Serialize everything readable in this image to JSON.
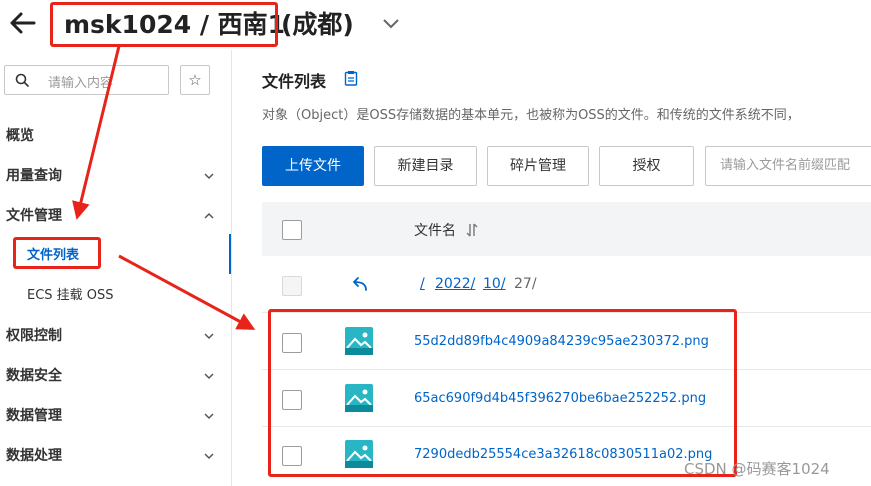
{
  "header": {
    "bucket_name": "msk1024 / 西南1",
    "region_suffix": "(成都)"
  },
  "sidebar": {
    "search_placeholder": "请输入内容",
    "items": [
      {
        "label": "概览"
      },
      {
        "label": "用量查询"
      },
      {
        "label": "文件管理"
      },
      {
        "label": "文件列表"
      },
      {
        "label": "ECS 挂载 OSS"
      },
      {
        "label": "权限控制"
      },
      {
        "label": "数据安全"
      },
      {
        "label": "数据管理"
      },
      {
        "label": "数据处理"
      }
    ]
  },
  "main": {
    "title": "文件列表",
    "description": "对象（Object）是OSS存储数据的基本单元，也被称为OSS的文件。和传统的文件系统不同，",
    "buttons": {
      "upload": "上传文件",
      "new_dir": "新建目录",
      "fragments": "碎片管理",
      "authorize": "授权"
    },
    "file_search_placeholder": "请输入文件名前缀匹配",
    "table": {
      "col_filename": "文件名",
      "breadcrumb": [
        "/",
        "2022/",
        "10/",
        "27/"
      ],
      "files": [
        "55d2dd89fb4c4909a84239c95ae230372.png",
        "65ac690f9d4b45f396270be6bae252252.png",
        "7290dedb25554ce3a32618c0830511a02.png"
      ]
    }
  },
  "watermark": "CSDN @码赛客1024",
  "colors": {
    "primary": "#0064c8",
    "annotation": "#e8231a"
  }
}
